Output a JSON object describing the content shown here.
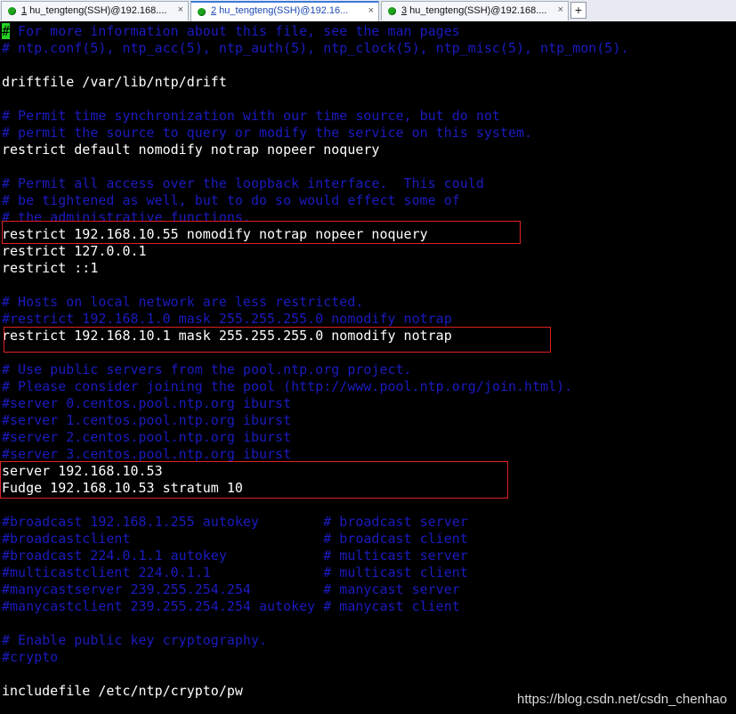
{
  "tabs": [
    {
      "num": "1",
      "title": " hu_tengteng(SSH)@192.168....",
      "close": "×"
    },
    {
      "num": "2",
      "title": " hu_tengteng(SSH)@192.16...",
      "close": "×"
    },
    {
      "num": "3",
      "title": " hu_tengteng(SSH)@192.168....",
      "close": "×"
    }
  ],
  "active_tab": 1,
  "new_tab_label": "+",
  "colors": {
    "comment": "#1b1bbf",
    "text": "#ffffff",
    "cursor": "#22d422",
    "highlight_box": "#e02020",
    "tab_active": "#3a78d8",
    "status_dot": "#1fa31f"
  },
  "terminal": {
    "cursor_char": "#",
    "lines": [
      {
        "t": " For more information about this file, see the man pages",
        "k": "c"
      },
      {
        "t": "# ntp.conf(5), ntp_acc(5), ntp_auth(5), ntp_clock(5), ntp_misc(5), ntp_mon(5).",
        "k": "c"
      },
      {
        "t": "",
        "k": "c"
      },
      {
        "t": "driftfile /var/lib/ntp/drift",
        "k": "w"
      },
      {
        "t": "",
        "k": "c"
      },
      {
        "t": "# Permit time synchronization with our time source, but do not",
        "k": "c"
      },
      {
        "t": "# permit the source to query or modify the service on this system.",
        "k": "c"
      },
      {
        "t": "restrict default nomodify notrap nopeer noquery",
        "k": "w"
      },
      {
        "t": "",
        "k": "c"
      },
      {
        "t": "# Permit all access over the loopback interface.  This could",
        "k": "c"
      },
      {
        "t": "# be tightened as well, but to do so would effect some of",
        "k": "c"
      },
      {
        "t": "# the administrative functions.",
        "k": "c"
      },
      {
        "t": "restrict 192.168.10.55 nomodify notrap nopeer noquery",
        "k": "w"
      },
      {
        "t": "restrict 127.0.0.1",
        "k": "w"
      },
      {
        "t": "restrict ::1",
        "k": "w"
      },
      {
        "t": "",
        "k": "c"
      },
      {
        "t": "# Hosts on local network are less restricted.",
        "k": "c"
      },
      {
        "t": "#restrict 192.168.1.0 mask 255.255.255.0 nomodify notrap",
        "k": "c"
      },
      {
        "t": "restrict 192.168.10.1 mask 255.255.255.0 nomodify notrap",
        "k": "w"
      },
      {
        "t": "",
        "k": "c"
      },
      {
        "t": "# Use public servers from the pool.ntp.org project.",
        "k": "c"
      },
      {
        "t": "# Please consider joining the pool (http://www.pool.ntp.org/join.html).",
        "k": "c"
      },
      {
        "t": "#server 0.centos.pool.ntp.org iburst",
        "k": "c"
      },
      {
        "t": "#server 1.centos.pool.ntp.org iburst",
        "k": "c"
      },
      {
        "t": "#server 2.centos.pool.ntp.org iburst",
        "k": "c"
      },
      {
        "t": "#server 3.centos.pool.ntp.org iburst",
        "k": "c"
      },
      {
        "t": "server 192.168.10.53",
        "k": "w"
      },
      {
        "t": "Fudge 192.168.10.53 stratum 10",
        "k": "w"
      },
      {
        "t": "",
        "k": "c"
      },
      {
        "t": "#broadcast 192.168.1.255 autokey        # broadcast server",
        "k": "c"
      },
      {
        "t": "#broadcastclient                        # broadcast client",
        "k": "c"
      },
      {
        "t": "#broadcast 224.0.1.1 autokey            # multicast server",
        "k": "c"
      },
      {
        "t": "#multicastclient 224.0.1.1              # multicast client",
        "k": "c"
      },
      {
        "t": "#manycastserver 239.255.254.254         # manycast server",
        "k": "c"
      },
      {
        "t": "#manycastclient 239.255.254.254 autokey # manycast client",
        "k": "c"
      },
      {
        "t": "",
        "k": "c"
      },
      {
        "t": "# Enable public key cryptography.",
        "k": "c"
      },
      {
        "t": "#crypto",
        "k": "c"
      },
      {
        "t": "",
        "k": "c"
      },
      {
        "t": "includefile /etc/ntp/crypto/pw",
        "k": "w"
      }
    ]
  },
  "watermark": "https://blog.csdn.net/csdn_chenhao"
}
